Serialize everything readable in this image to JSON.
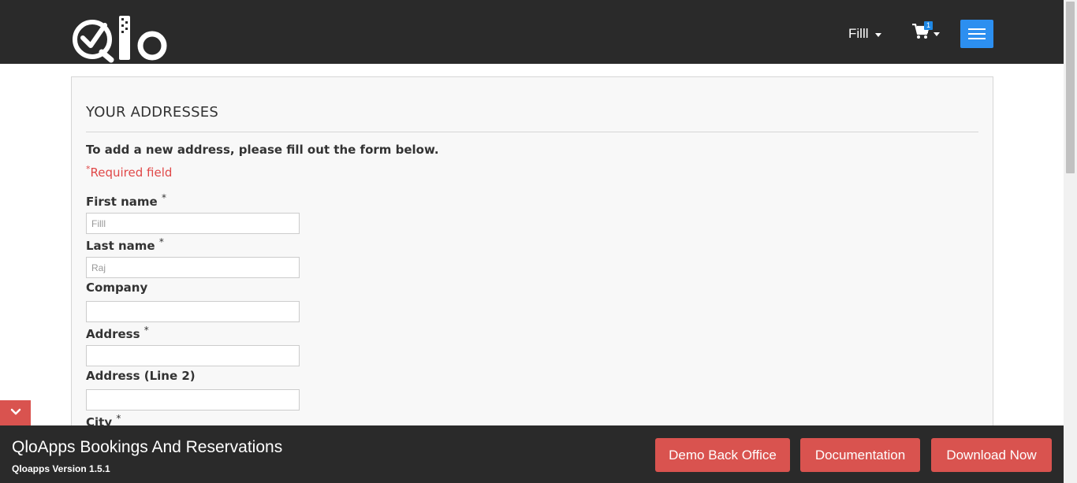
{
  "header": {
    "logo_icon": "qlo-logo",
    "user_name": "Filll",
    "cart_count": "1",
    "cart_icon": "cart-icon",
    "menu_icon": "hamburger-icon",
    "accent": "#2c8ff0"
  },
  "form": {
    "title": "YOUR ADDRESSES",
    "info": "To add a new address, please fill out the form below.",
    "required_mark": "*",
    "required_note": "Required field",
    "fields": [
      {
        "label": "First name",
        "required": "*",
        "value": "Filll"
      },
      {
        "label": "Last name",
        "required": "*",
        "value": "Raj"
      },
      {
        "label": "Company",
        "required": "",
        "value": ""
      },
      {
        "label": "Address",
        "required": "*",
        "value": ""
      },
      {
        "label": "Address (Line 2)",
        "required": "",
        "value": ""
      },
      {
        "label": "City",
        "required": "*",
        "value": ""
      }
    ]
  },
  "footer": {
    "title": "QloApps Bookings And Reservations",
    "version": "Qloapps Version 1.5.1",
    "buttons": [
      "Demo Back Office",
      "Documentation",
      "Download Now"
    ],
    "toggle_icon": "chevron-down-icon",
    "button_color": "#d9534f"
  }
}
